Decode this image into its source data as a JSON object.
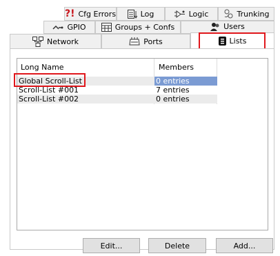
{
  "tabs_row1": [
    {
      "label": "Cfg Errors",
      "icon": "cfg-errors-icon"
    },
    {
      "label": "Log",
      "icon": "log-icon"
    },
    {
      "label": "Logic",
      "icon": "logic-icon"
    },
    {
      "label": "Trunking",
      "icon": "trunking-icon"
    }
  ],
  "tabs_row2": [
    {
      "label": "GPIO",
      "icon": "gpio-icon"
    },
    {
      "label": "Groups + Confs",
      "icon": "groups-icon"
    },
    {
      "label": "Users",
      "icon": "users-icon"
    }
  ],
  "tabs_row3": [
    {
      "label": "Network",
      "icon": "network-icon"
    },
    {
      "label": "Ports",
      "icon": "ports-icon"
    },
    {
      "label": "Lists",
      "icon": "lists-icon",
      "active": true
    }
  ],
  "table": {
    "columns": [
      "Long Name",
      "Members"
    ],
    "rows": [
      {
        "name": "Global Scroll-List",
        "members": "0 entries",
        "selected": true
      },
      {
        "name": "Scroll-List #001",
        "members": "7 entries"
      },
      {
        "name": "Scroll-List #002",
        "members": "0 entries"
      }
    ]
  },
  "buttons": {
    "edit": "Edit...",
    "delete": "Delete",
    "add": "Add..."
  },
  "colors": {
    "highlight": "#e0161b",
    "selection": "#7b9bd3",
    "cfg_error_mark": "#c8161d"
  }
}
